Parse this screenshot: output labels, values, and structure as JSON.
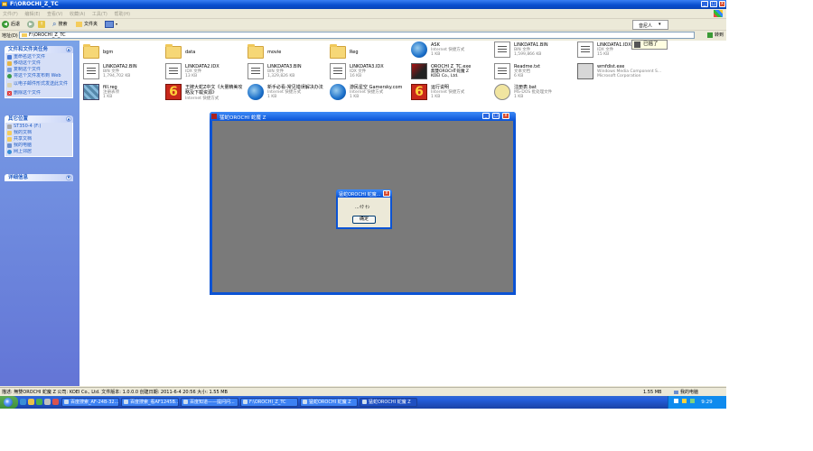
{
  "window": {
    "title": "F:\\OROCHI_Z_TC",
    "menu": [
      "文件(F)",
      "编辑(E)",
      "查看(V)",
      "收藏(A)",
      "工具(T)",
      "帮助(H)"
    ],
    "controls": {
      "min": "_",
      "max": "□",
      "close": "x"
    }
  },
  "toolbar": {
    "back": "后退",
    "search": "搜索",
    "folders": "文件夹"
  },
  "address": {
    "label": "地址(D)",
    "value": "F:\\OROCHI_Z_TC",
    "go": "转到"
  },
  "language_bar": {
    "label": "音尼人",
    "tip": "已摇了"
  },
  "tasks_panel": {
    "title": "文件和文件夹任务",
    "items": [
      "重命名这个文件",
      "移动这个文件",
      "复制这个文件",
      "将这个文件发布到 Web",
      "以电子邮件形式发送此文件",
      "删除这个文件"
    ]
  },
  "other_panel": {
    "title": "其它位置",
    "items": [
      "ST350-4 (F:)",
      "我的文档",
      "共享文档",
      "我的电脑",
      "网上邻居"
    ]
  },
  "details_panel": {
    "title": "详细信息"
  },
  "files": [
    {
      "name": "bgm",
      "icon": "folder",
      "l1": "",
      "l2": ""
    },
    {
      "name": "data",
      "icon": "folder",
      "l1": "",
      "l2": ""
    },
    {
      "name": "movie",
      "icon": "folder",
      "l1": "",
      "l2": ""
    },
    {
      "name": "Reg",
      "icon": "folder",
      "l1": "",
      "l2": ""
    },
    {
      "name": "ASK",
      "icon": "ie",
      "l1": "Internet 快捷方式",
      "l2": "1 KB"
    },
    {
      "name": "LINKDATA1.BIN",
      "icon": "doc",
      "l1": "BIN 文件",
      "l2": "1,599,866 KB"
    },
    {
      "name": "LINKDATA1.IDX",
      "icon": "doc",
      "l1": "IDX 文件",
      "l2": "15 KB"
    },
    {
      "name": "LINKDATA2.BIN",
      "icon": "doc",
      "l1": "BIN 文件",
      "l2": "1,794,702 KB"
    },
    {
      "name": "LINKDATA2.IDX",
      "icon": "doc",
      "l1": "IDX 文件",
      "l2": "13 KB"
    },
    {
      "name": "LINKDATA3.BIN",
      "icon": "doc",
      "l1": "BIN 文件",
      "l2": "1,329,826 KB"
    },
    {
      "name": "LINKDATA3.IDX",
      "icon": "doc",
      "l1": "IDX 文件",
      "l2": "16 KB"
    },
    {
      "name": "OROCHI Z_TC.exe",
      "icon": "game",
      "l1": "無雙OROCHI 蛇魔 Z",
      "l2": "KOEI Co., Ltd."
    },
    {
      "name": "Readme.txt",
      "icon": "doc",
      "l1": "文本文档",
      "l2": "6 KB"
    },
    {
      "name": "wmfdist.exe",
      "icon": "exe",
      "l1": "Windows Media Component S...",
      "l2": "Microsoft Corporation"
    },
    {
      "name": "fill.reg",
      "icon": "reg",
      "l1": "注册表项",
      "l2": "1 KB"
    },
    {
      "name": "王牌大蛇Z中文《大量精美攻略及下载资源》",
      "icon": "six",
      "l1": "Internet 快捷方式",
      "l2": ""
    },
    {
      "name": "新手必看-常见错误解决办法",
      "icon": "ie",
      "l1": "Internet 快捷方式",
      "l2": "1 KB"
    },
    {
      "name": "游民星空 Gamersky.com",
      "icon": "ie",
      "l1": "Internet 快捷方式",
      "l2": "1 KB"
    },
    {
      "name": "运行说明",
      "icon": "six",
      "l1": "Internet 快捷方式",
      "l2": "1 KB"
    },
    {
      "name": "注册表.bat",
      "icon": "bat",
      "l1": "MS-DOS 批处理文件",
      "l2": "1 KB"
    }
  ],
  "app_window": {
    "title": "猛蛇OROCHI 蛇魔 Z",
    "controls": {
      "min": "_",
      "max": "□",
      "close": "x"
    }
  },
  "dialog": {
    "title": "猛蛇OROCHI 蛇魔...",
    "message": "...ｲｸ ｹﾝ",
    "ok": "确定",
    "close": "x"
  },
  "status": {
    "description": "描述: 無雙OROCHI 蛇魔 Z 公司: KOEI Co., Ltd. 文件版本: 1.0.0.0 创建日期: 2011-6-4 20:56 大小: 1.55 MB",
    "size": "1.55 MB",
    "location": "我的电脑"
  },
  "taskbar": {
    "tasks": [
      "百度搜索_AF-24B-32...",
      "百度搜索_看AF1245B...",
      "百度知道——提问问...",
      "F:\\OROCHI_Z_TC",
      "猛蛇OROCHI 蛇魔 Z",
      "猛蛇OROCHI 蛇魔 Z"
    ],
    "clock": "9:29"
  }
}
